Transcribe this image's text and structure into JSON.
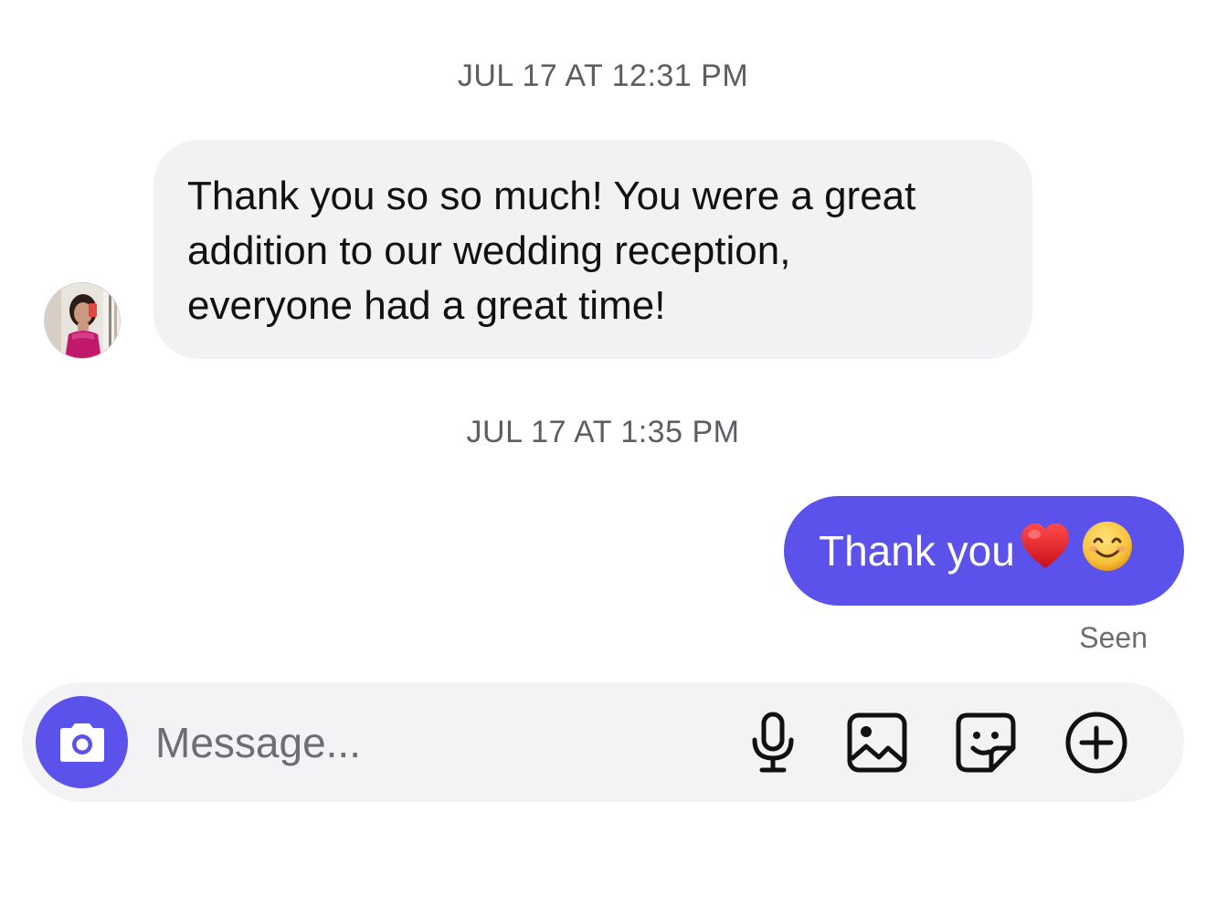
{
  "thread": {
    "timestamp_1": "JUL 17 AT 12:31 PM",
    "incoming_message": {
      "lines": [
        "Thank you so so much! You were a great",
        "addition to our wedding reception,",
        "everyone had a great time!"
      ]
    },
    "timestamp_2": "JUL 17 AT 1:35 PM",
    "outgoing_message": {
      "text": "Thank you",
      "emojis": [
        "red-heart",
        "smiling-face"
      ]
    },
    "seen_label": "Seen"
  },
  "composer": {
    "placeholder": "Message...",
    "icons": [
      "camera-icon",
      "microphone-icon",
      "gallery-icon",
      "sticker-icon",
      "plus-icon"
    ]
  },
  "colors": {
    "accent": "#5b51eb",
    "incoming_bubble": "#f2f2f4",
    "composer_bg": "#f3f3f5",
    "timestamp_text": "#5d5d63"
  }
}
